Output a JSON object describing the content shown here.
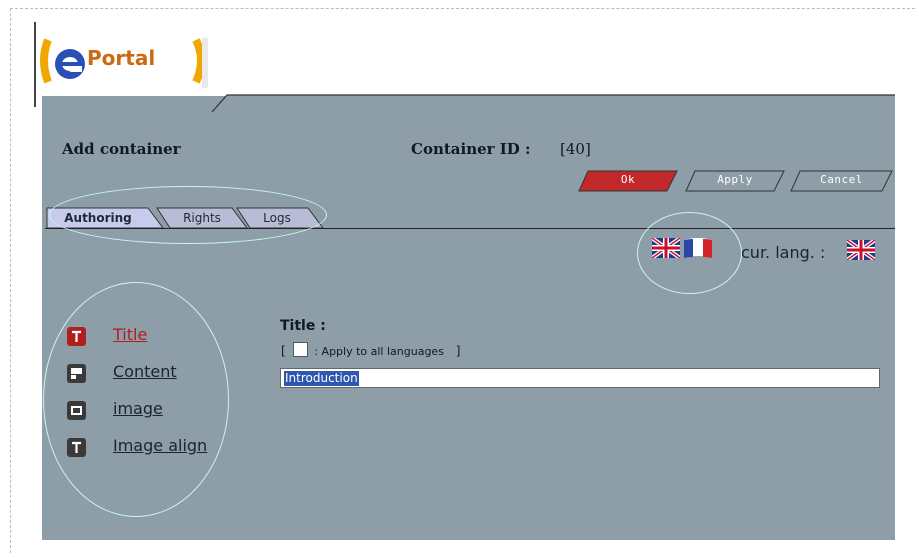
{
  "logo": {
    "brand": "ePortal"
  },
  "header": {
    "title": "Add container",
    "container_id_label": "Container ID :",
    "container_id_value": "[40]"
  },
  "buttons": {
    "ok": "Ok",
    "apply": "Apply",
    "cancel": "Cancel"
  },
  "tabs": [
    {
      "label": "Authoring",
      "active": true
    },
    {
      "label": "Rights",
      "active": false
    },
    {
      "label": "Logs",
      "active": false
    }
  ],
  "languages": {
    "flags": [
      "uk-flag-icon",
      "fr-flag-icon"
    ],
    "current_label": "cur. lang. :",
    "current_flag": "uk-flag-icon"
  },
  "sidebar": {
    "items": [
      {
        "label": "Title",
        "icon": "text-type-icon",
        "active": true
      },
      {
        "label": "Content",
        "icon": "content-type-icon",
        "active": false
      },
      {
        "label": "image",
        "icon": "image-type-icon",
        "active": false
      },
      {
        "label": "Image align",
        "icon": "text-type-icon",
        "active": false
      }
    ]
  },
  "form": {
    "field_label": "Title :",
    "apply_all_open": "[",
    "apply_all_label": ": Apply to all languages",
    "apply_all_close": "]",
    "title_value": "Introduction"
  },
  "colors": {
    "panel": "#8d9ea8",
    "ok_button": "#c0282a",
    "active_item": "#b01e1e",
    "annotation": "#c9f5f2"
  }
}
